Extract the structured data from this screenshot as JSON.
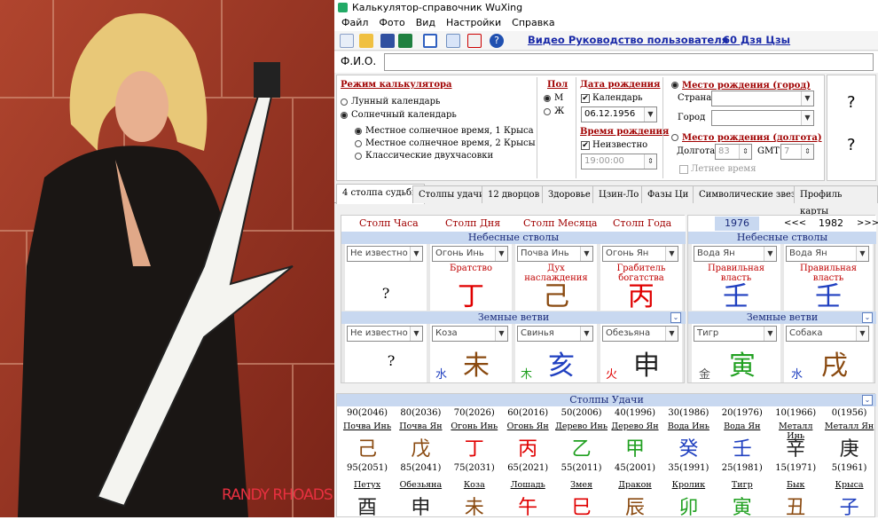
{
  "window": {
    "title": "Калькулятор-справочник WuXing"
  },
  "menu": [
    "Файл",
    "Фото",
    "Вид",
    "Настройки",
    "Справка"
  ],
  "toolbar": {
    "video_link": "Видео Руководство пользователя",
    "link_60": "60 Дзя Цзы"
  },
  "photo": {
    "caption": "RANDY RHOADS"
  },
  "fio": {
    "label": "Ф.И.О.",
    "value": ""
  },
  "mode": {
    "header": "Режим калькулятора",
    "lunar": "Лунный календарь",
    "solar": "Солнечный календарь",
    "opt1": "Местное солнечное время, 1 Крыса",
    "opt2": "Местное солнечное время, 2 Крысы",
    "opt3": "Классические двухчасовки"
  },
  "gender": {
    "header": "Пол",
    "male": "М",
    "female": "Ж"
  },
  "birthdate": {
    "header": "Дата рождения",
    "calendar_label": "Календарь",
    "date": "06.12.1956",
    "time_header": "Время рождения",
    "unknown_label": "Неизвестно",
    "time": "19:00:00"
  },
  "place": {
    "city_header": "Место рождения (город)",
    "country_label": "Страна",
    "city_label": "Город",
    "long_header": "Место рождения (долгота)",
    "long_label": "Долгота",
    "long_value": "83",
    "gmt_label": "GMT",
    "gmt_value": "7",
    "summer": "Летнее время"
  },
  "qmarks": {
    "q1": "?",
    "q2": "?"
  },
  "tabs": [
    "4 столпа судьбы",
    "Столпы удачи",
    "12 дворцов",
    "Здоровье",
    "Цзин-Ло",
    "Фазы Ци",
    "Символические звезды",
    "Профиль карты"
  ],
  "pillars": {
    "headers": [
      "Столп Часа",
      "Столп Дня",
      "Столп Месяца",
      "Столп Года"
    ],
    "stems_band": "Небесные стволы",
    "branches_band": "Земные ветви",
    "stem_selects": [
      "Не известно",
      "Огонь Инь",
      "Почва Инь",
      "Огонь Ян"
    ],
    "stem_gods": [
      "",
      "Братство",
      "Дух наслаждения",
      "Грабитель богатства"
    ],
    "stem_chars": [
      "?",
      "丁",
      "己",
      "丙"
    ],
    "stem_colors": [
      "#000000",
      "#e00000",
      "#8a4a10",
      "#e00000"
    ],
    "branch_selects": [
      "Не известно",
      "Коза",
      "Свинья",
      "Обезьяна"
    ],
    "branch_hidden": [
      "",
      "水",
      "木",
      "火"
    ],
    "branch_hidden_colors": [
      "#000",
      "#2040c0",
      "#20a020",
      "#e00000"
    ],
    "branch_chars": [
      "?",
      "未",
      "亥",
      "申"
    ],
    "branch_colors": [
      "#000000",
      "#8a4a10",
      "#2040c0",
      "#222222"
    ]
  },
  "side": {
    "year": "1976",
    "prev": "<<<",
    "year2": "1982",
    "next": ">>>",
    "stems_band": "Небесные стволы",
    "branches_band": "Земные ветви",
    "stem_selects": [
      "Вода Ян",
      "Вода Ян"
    ],
    "stem_gods": [
      "Правильная власть",
      "Правильная власть"
    ],
    "stem_chars": [
      "壬",
      "壬"
    ],
    "branch_selects": [
      "Тигр",
      "Собака"
    ],
    "branch_hidden": [
      "金",
      "水"
    ],
    "branch_hidden_colors": [
      "#555",
      "#2040c0"
    ],
    "branch_chars": [
      "寅",
      "戌"
    ],
    "branch_colors": [
      "#20a020",
      "#8a4a10"
    ]
  },
  "luck": {
    "band": "Столпы Удачи",
    "top_years": [
      "90(2046)",
      "80(2036)",
      "70(2026)",
      "60(2016)",
      "50(2006)",
      "40(1996)",
      "30(1986)",
      "20(1976)",
      "10(1966)",
      "0(1956)"
    ],
    "top_labels": [
      "Почва Инь",
      "Почва Ян",
      "Огонь Инь",
      "Огонь Ян",
      "Дерево Инь",
      "Дерево Ян",
      "Вода Инь",
      "Вода Ян",
      "Металл Инь",
      "Металл Ян"
    ],
    "top_chars": [
      "己",
      "戊",
      "丁",
      "丙",
      "乙",
      "甲",
      "癸",
      "壬",
      "辛",
      "庚"
    ],
    "top_colors": [
      "#8a4a10",
      "#8a4a10",
      "#e00000",
      "#e00000",
      "#20a020",
      "#20a020",
      "#2040c0",
      "#2040c0",
      "#222222",
      "#222222"
    ],
    "bot_years": [
      "95(2051)",
      "85(2041)",
      "75(2031)",
      "65(2021)",
      "55(2011)",
      "45(2001)",
      "35(1991)",
      "25(1981)",
      "15(1971)",
      "5(1961)"
    ],
    "bot_labels": [
      "Петух",
      "Обезьяна",
      "Коза",
      "Лошадь",
      "Змея",
      "Дракон",
      "Кролик",
      "Тигр",
      "Бык",
      "Крыса"
    ],
    "bot_chars": [
      "酉",
      "申",
      "未",
      "午",
      "巳",
      "辰",
      "卯",
      "寅",
      "丑",
      "子"
    ],
    "bot_colors": [
      "#222222",
      "#222222",
      "#8a4a10",
      "#e00000",
      "#e00000",
      "#8a4a10",
      "#20a020",
      "#20a020",
      "#8a4a10",
      "#2040c0"
    ]
  }
}
